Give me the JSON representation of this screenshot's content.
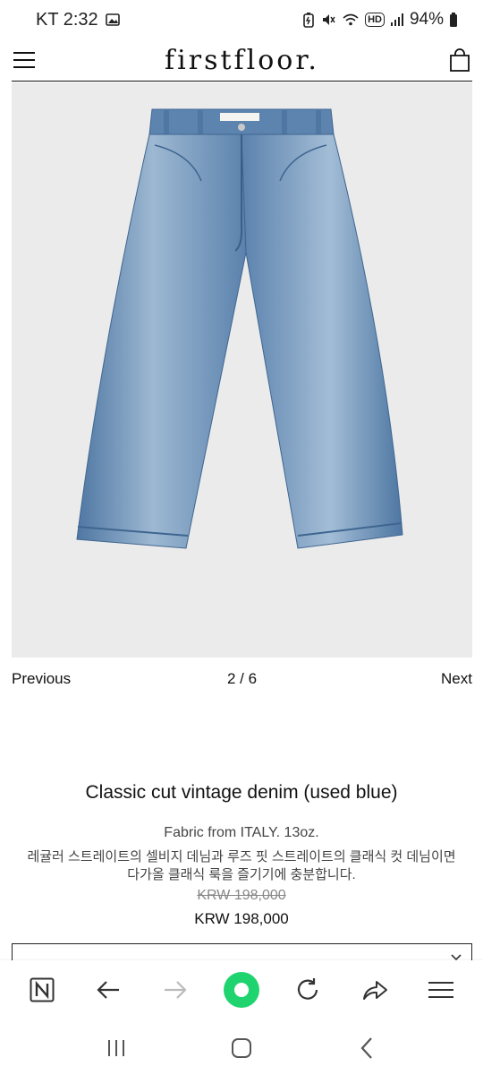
{
  "status_bar": {
    "carrier_time": "KT 2:32",
    "battery": "94%",
    "hd_label": "HD"
  },
  "header": {
    "logo": "firstfloor."
  },
  "gallery": {
    "previous_label": "Previous",
    "counter": "2 / 6",
    "next_label": "Next"
  },
  "product": {
    "title": "Classic cut vintage denim (used blue)",
    "fabric": "Fabric from ITALY. 13oz.",
    "description_line1": "레귤러 스트레이트의 셀비지 데님과 루즈 핏 스트레이트의 클래식 컷 데님이면",
    "description_line2": "다가올 클래식 룩을 즐기기에 충분합니다.",
    "price_original": "KRW 198,000",
    "price_current": "KRW 198,000"
  },
  "colors": {
    "denim": "#6a8db3",
    "image_bg": "#ebebeb",
    "accent_green": "#1fd46e"
  }
}
